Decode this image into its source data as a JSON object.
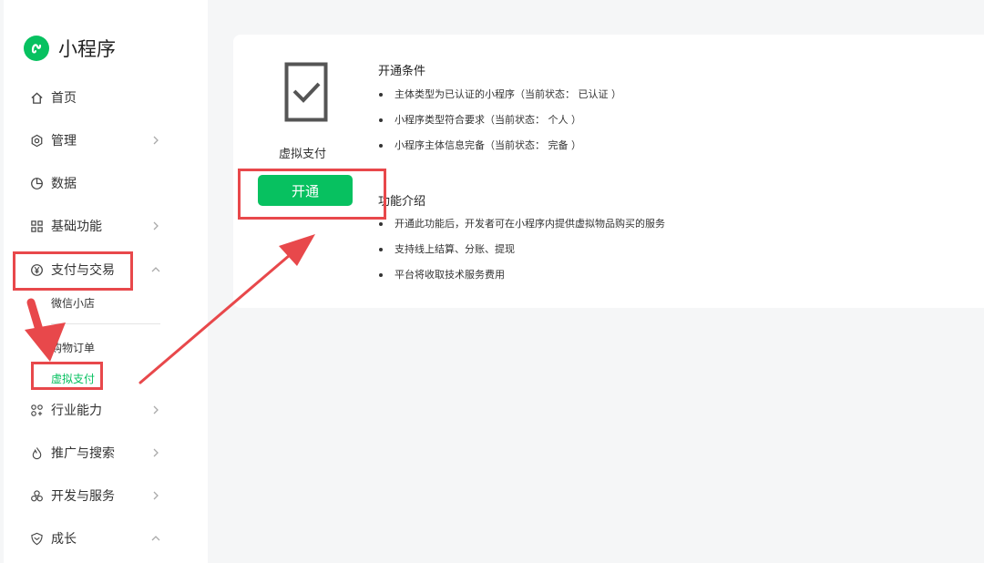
{
  "brand": {
    "title": "小程序",
    "icon": "mini-program-logo-icon",
    "color": "#07c160"
  },
  "sidebar": {
    "items": [
      {
        "label": "首页",
        "icon": "home-icon"
      },
      {
        "label": "管理",
        "icon": "settings-icon"
      },
      {
        "label": "数据",
        "icon": "pie-chart-icon"
      },
      {
        "label": "基础功能",
        "icon": "grid-icon"
      },
      {
        "label": "支付与交易",
        "icon": "yen-icon"
      },
      {
        "label": "行业能力",
        "icon": "apps-icon"
      },
      {
        "label": "推广与搜索",
        "icon": "flame-icon"
      },
      {
        "label": "开发与服务",
        "icon": "circles-icon"
      },
      {
        "label": "成长",
        "icon": "shield-icon"
      }
    ],
    "payment_sub": [
      {
        "label": "微信小店"
      },
      {
        "label": "购物订单"
      },
      {
        "label": "虚拟支付",
        "active": true
      }
    ]
  },
  "feature": {
    "name": "虚拟支付",
    "button_label": "开通",
    "conditions_title": "开通条件",
    "conditions": [
      "主体类型为已认证的小程序（当前状态： 已认证 ）",
      "小程序类型符合要求（当前状态： 个人 ）",
      "小程序主体信息完备（当前状态： 完备 ）"
    ],
    "intro_title": "功能介绍",
    "intro": [
      "开通此功能后，开发者可在小程序内提供虚拟物品购买的服务",
      "支持线上结算、分账、提现",
      "平台将收取技术服务费用"
    ]
  },
  "colors": {
    "accent": "#07c160",
    "annotation": "#e8484b"
  }
}
